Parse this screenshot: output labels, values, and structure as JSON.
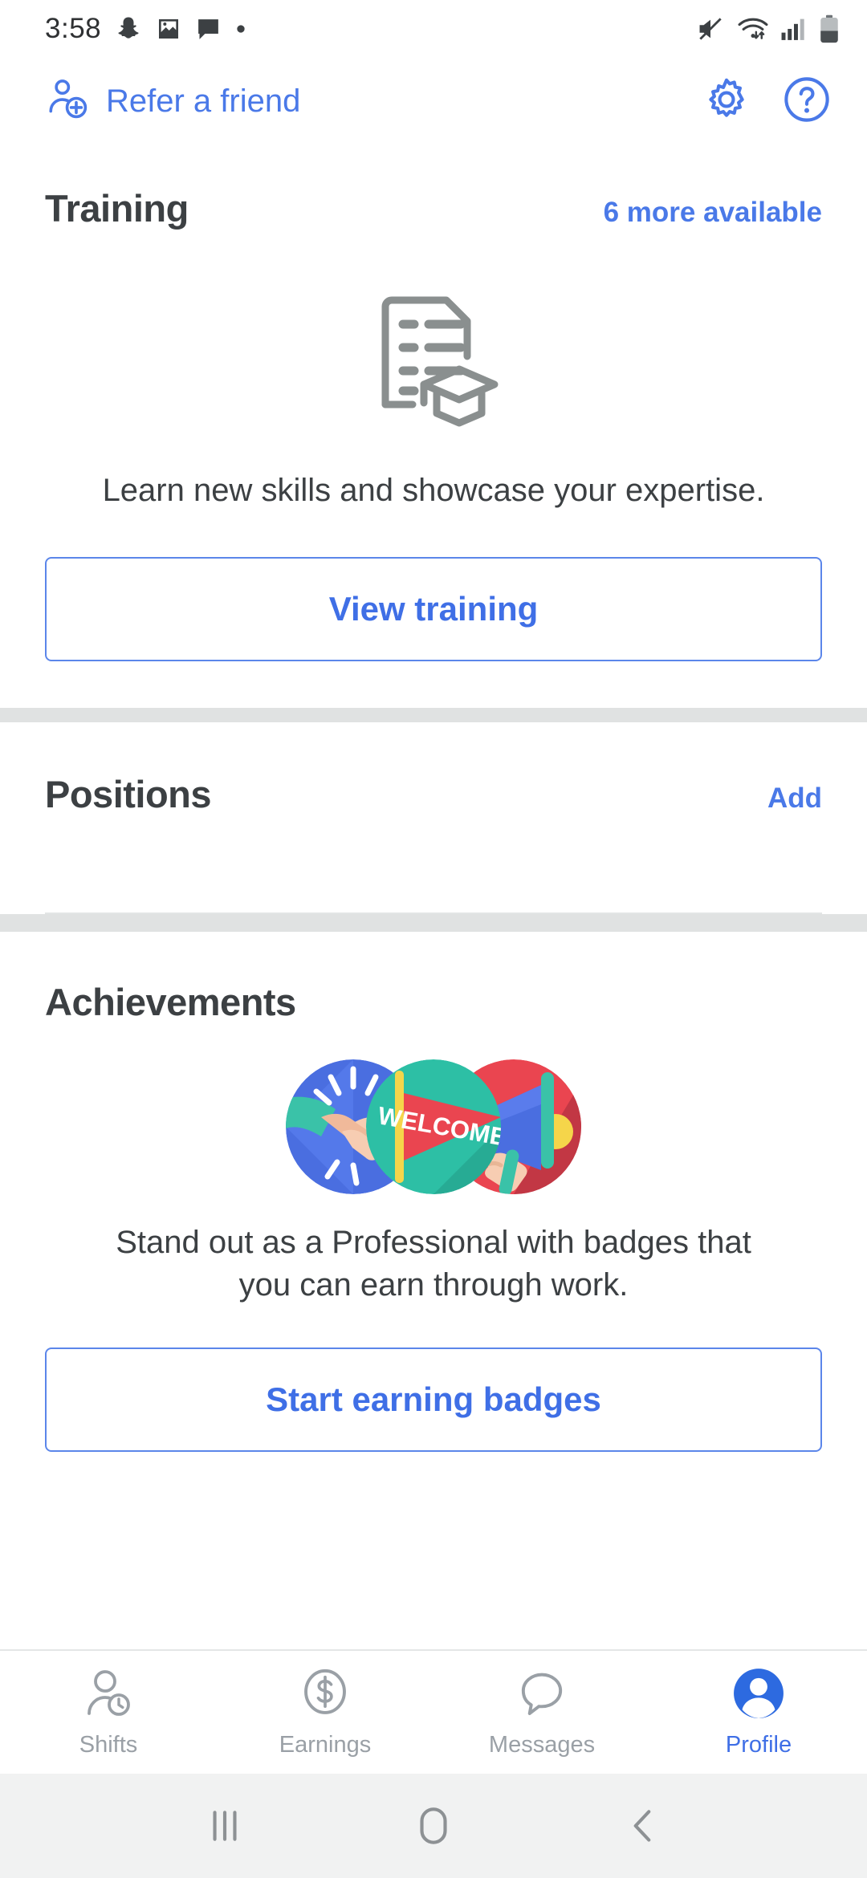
{
  "status_bar": {
    "time": "3:58",
    "left_icons": [
      "snapchat-icon",
      "photo-icon",
      "message-icon",
      "dot-icon"
    ],
    "right_icons": [
      "mute-icon",
      "wifi-icon",
      "cellular-signal-icon",
      "battery-icon"
    ]
  },
  "app_bar": {
    "refer_label": "Refer a friend",
    "refer_icon": "person-add-icon",
    "settings_icon": "gear-icon",
    "help_icon": "help-circle-icon"
  },
  "training": {
    "title": "Training",
    "action": "6 more available",
    "illustration": "document-graduation-cap-icon",
    "description": "Learn new skills and showcase your expertise.",
    "button": "View training"
  },
  "positions": {
    "title": "Positions",
    "action": "Add"
  },
  "achievements": {
    "title": "Achievements",
    "illustration": "badges-handshake-welcome-megaphone",
    "badge_text": "WELCOME",
    "description_line1": "Stand out as a Professional with badges that",
    "description_line2": "you can earn through work.",
    "button": "Start earning badges"
  },
  "tab_bar": {
    "items": [
      {
        "label": "Shifts",
        "icon": "person-clock-icon",
        "active": false
      },
      {
        "label": "Earnings",
        "icon": "dollar-circle-icon",
        "active": false
      },
      {
        "label": "Messages",
        "icon": "chat-bubble-icon",
        "active": false
      },
      {
        "label": "Profile",
        "icon": "person-filled-icon",
        "active": true
      }
    ]
  },
  "system_nav": {
    "recents": "recents-icon",
    "home": "home-icon",
    "back": "back-icon"
  },
  "colors": {
    "accent_blue": "#4a79e8",
    "button_blue": "#3f6fe6",
    "text_dark": "#3c4043",
    "muted_gray": "#9aa0a6",
    "divider_gray": "#e0e2e2"
  }
}
